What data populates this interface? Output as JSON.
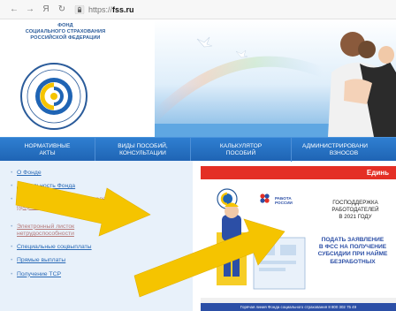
{
  "browser": {
    "back_label": "←",
    "forward_label": "→",
    "yandex_label": "Я",
    "reload_label": "↻",
    "url_protocol": "https://",
    "url_host": "fss.ru"
  },
  "header": {
    "org_line1": "ФОНД",
    "org_line2": "СОЦИАЛЬНОГО СТРАХОВАНИЯ",
    "org_line3": "РОССИЙСКОЙ ФЕДЕРАЦИИ"
  },
  "menu": {
    "items": [
      {
        "line1": "НОРМАТИВНЫЕ",
        "line2": "АКТЫ"
      },
      {
        "line1": "ВИДЫ ПОСОБИЙ,",
        "line2": "КОНСУЛЬТАЦИИ"
      },
      {
        "line1": "КАЛЬКУЛЯТОР",
        "line2": "ПОСОБИЙ"
      },
      {
        "line1": "АДМИНИСТРИРОВАНИ",
        "line2": "ВЗНОСОВ"
      }
    ]
  },
  "sidebar": {
    "items": [
      {
        "label": "О Фонде"
      },
      {
        "label": "Деятельность Фонда"
      },
      {
        "label": "Информация для работодателей",
        "sub": "(формы отчетности, бланки)"
      },
      {
        "label": "Электронный листок нетрудоспособности"
      },
      {
        "label": "Специальные соцвыплаты"
      },
      {
        "label": "Прямые выплаты"
      },
      {
        "label": "Получение ТСР"
      }
    ]
  },
  "banner": {
    "top_label": "Единь",
    "rabota_line1": "РАБОТА",
    "rabota_line2": "РОССИИ",
    "title_line1": "ГОСПОДДЕРЖКА",
    "title_line2": "РАБОТОДАТЕЛЕЙ",
    "title_line3": "В 2021 ГОДУ",
    "cta_line1": "ПОДАТЬ ЗАЯВЛЕНИЕ",
    "cta_line2": "В ФСС НА ПОЛУЧЕНИЕ",
    "cta_line3": "СУБСИДИИ ПРИ НАЙМЕ",
    "cta_line4": "БЕЗРАБОТНЫХ",
    "hotline": "Горячая линия Фонда социального страхования 8 800 302 75 49"
  },
  "colors": {
    "menu_blue": "#1f64b4",
    "banner_red": "#e42f25",
    "arrow_yellow": "#f5c400",
    "link_blue": "#2a6ab6"
  }
}
